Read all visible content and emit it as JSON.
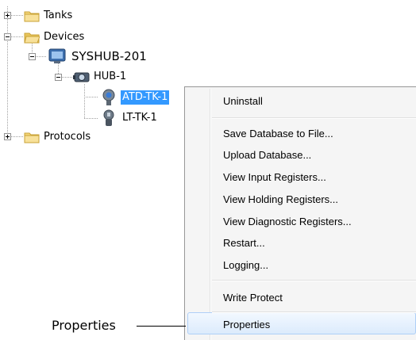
{
  "tree": {
    "tanks_label": "Tanks",
    "devices_label": "Devices",
    "syshub_label": "SYSHUB-201",
    "hub_label": "HUB-1",
    "atd_label": "ATD-TK-1",
    "lt_label": "LT-TK-1",
    "protocols_label": "Protocols"
  },
  "context_menu": {
    "items": [
      "Uninstall",
      "Save Database to File...",
      "Upload Database...",
      "View Input Registers...",
      "View Holding Registers...",
      "View Diagnostic Registers...",
      "Restart...",
      "Logging...",
      "Write Protect",
      "Properties"
    ]
  },
  "callout": {
    "label": "Properties"
  },
  "icons": {
    "folder": "folder-icon",
    "folder_open": "folder-open-icon",
    "syshub": "computer-icon",
    "hub": "hub-icon",
    "atd": "gauge-device-icon",
    "lt": "level-transmitter-icon"
  },
  "colors": {
    "selection": "#3399ff",
    "folder": "#f4d67a",
    "menu_hover": "#dcebfc"
  }
}
